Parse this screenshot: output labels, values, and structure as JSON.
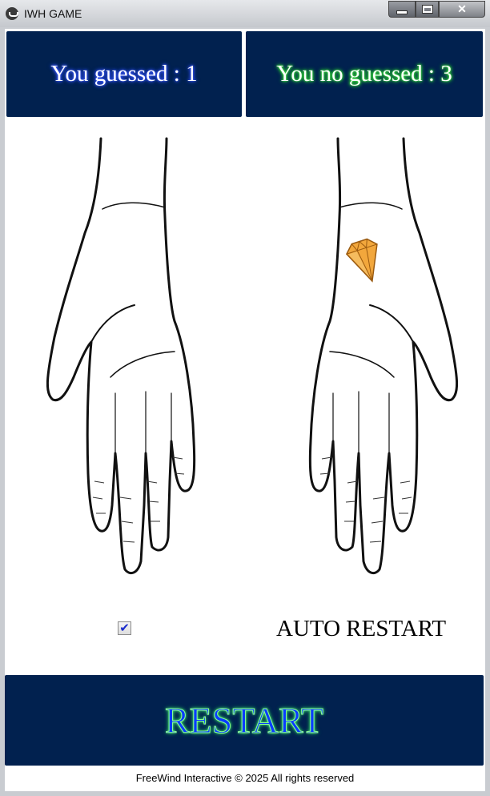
{
  "window": {
    "title": "IWH GAME"
  },
  "scores": {
    "guessed": "You guessed : 1",
    "not_guessed": "You no guessed : 3"
  },
  "hands": {
    "left": {
      "contains_gem": false
    },
    "right": {
      "contains_gem": true,
      "gem_color": "#f0a43a"
    }
  },
  "auto_restart": {
    "checked": true,
    "label": "AUTO RESTART"
  },
  "restart_button": {
    "label": "RESTART"
  },
  "footer": {
    "text": "FreeWind Interactive © 2025 All rights reserved"
  },
  "colors": {
    "panel_bg": "#01214f",
    "guess_glow": "#3d5bff",
    "noguess_glow": "#2fd42f"
  }
}
